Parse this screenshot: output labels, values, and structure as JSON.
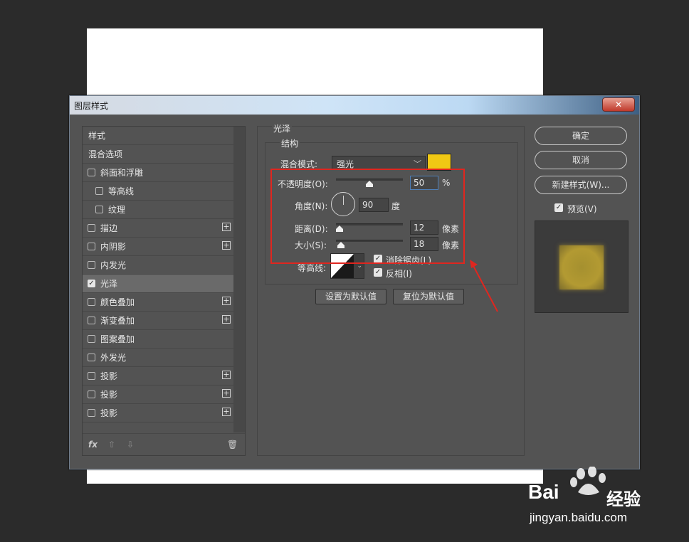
{
  "dialog": {
    "title": "图层样式",
    "close_label": "✕"
  },
  "left_list": {
    "items": [
      {
        "label": "样式",
        "checkbox": false,
        "checked": false,
        "plus": false,
        "indent": false,
        "active": false
      },
      {
        "label": "混合选项",
        "checkbox": false,
        "checked": false,
        "plus": false,
        "indent": false,
        "active": false
      },
      {
        "label": "斜面和浮雕",
        "checkbox": true,
        "checked": false,
        "plus": false,
        "indent": false,
        "active": false
      },
      {
        "label": "等高线",
        "checkbox": true,
        "checked": false,
        "plus": false,
        "indent": true,
        "active": false
      },
      {
        "label": "纹理",
        "checkbox": true,
        "checked": false,
        "plus": false,
        "indent": true,
        "active": false
      },
      {
        "label": "描边",
        "checkbox": true,
        "checked": false,
        "plus": true,
        "indent": false,
        "active": false
      },
      {
        "label": "内阴影",
        "checkbox": true,
        "checked": false,
        "plus": true,
        "indent": false,
        "active": false
      },
      {
        "label": "内发光",
        "checkbox": true,
        "checked": false,
        "plus": false,
        "indent": false,
        "active": false
      },
      {
        "label": "光泽",
        "checkbox": true,
        "checked": true,
        "plus": false,
        "indent": false,
        "active": true
      },
      {
        "label": "颜色叠加",
        "checkbox": true,
        "checked": false,
        "plus": true,
        "indent": false,
        "active": false
      },
      {
        "label": "渐变叠加",
        "checkbox": true,
        "checked": false,
        "plus": true,
        "indent": false,
        "active": false
      },
      {
        "label": "图案叠加",
        "checkbox": true,
        "checked": false,
        "plus": false,
        "indent": false,
        "active": false
      },
      {
        "label": "外发光",
        "checkbox": true,
        "checked": false,
        "plus": false,
        "indent": false,
        "active": false
      },
      {
        "label": "投影",
        "checkbox": true,
        "checked": false,
        "plus": true,
        "indent": false,
        "active": false
      },
      {
        "label": "投影",
        "checkbox": true,
        "checked": false,
        "plus": true,
        "indent": false,
        "active": false
      },
      {
        "label": "投影",
        "checkbox": true,
        "checked": false,
        "plus": true,
        "indent": false,
        "active": false
      }
    ],
    "footer": {
      "fx": "fx",
      "up": "⇧",
      "down": "⇩",
      "trash": "🗑"
    }
  },
  "satin": {
    "group_label": "光泽",
    "structure_label": "结构",
    "blend_mode_label": "混合模式:",
    "blend_mode_value": "强光",
    "color": "#f0c814",
    "opacity_label": "不透明度(O):",
    "opacity_value": "50",
    "opacity_unit": "%",
    "opacity_fraction": 0.5,
    "angle_label": "角度(N):",
    "angle_value": "90",
    "angle_unit": "度",
    "distance_label": "距离(D):",
    "distance_value": "12",
    "distance_unit": "像素",
    "distance_fraction": 0.05,
    "size_label": "大小(S):",
    "size_value": "18",
    "size_unit": "像素",
    "size_fraction": 0.07,
    "contour_label": "等高线:",
    "anti_alias_label": "消除锯齿(L)",
    "anti_alias_checked": true,
    "invert_label": "反相(I)",
    "invert_checked": true,
    "set_default_label": "设置为默认值",
    "reset_default_label": "复位为默认值"
  },
  "right": {
    "ok_label": "确定",
    "cancel_label": "取消",
    "new_style_label": "新建样式(W)...",
    "preview_label": "预览(V)",
    "preview_checked": true
  },
  "watermark": {
    "brand_left": "Bai",
    "brand_right": "经验",
    "url": "jingyan.baidu.com"
  }
}
